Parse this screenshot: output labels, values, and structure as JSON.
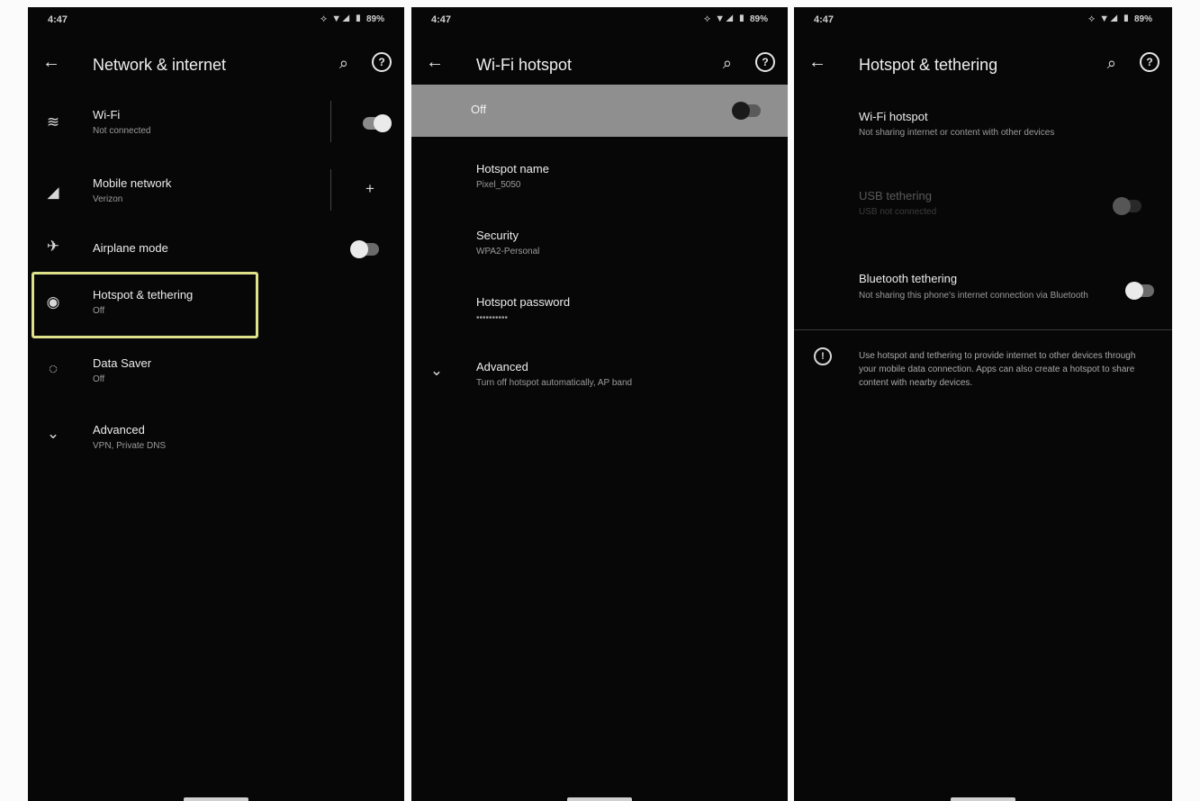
{
  "screens": [
    {
      "status": {
        "time": "4:47",
        "icons": "⟡ ▼◢ ▮",
        "battery": "89%"
      },
      "appbar": {
        "title": "Network & internet"
      },
      "rows": [
        {
          "label": "Wi-Fi",
          "sub": "Not connected"
        },
        {
          "label": "Mobile network",
          "sub": "Verizon"
        },
        {
          "label": "Airplane mode",
          "sub": ""
        },
        {
          "label": "Hotspot & tethering",
          "sub": "Off"
        },
        {
          "label": "Data Saver",
          "sub": "Off"
        },
        {
          "label": "Advanced",
          "sub": "VPN, Private DNS"
        }
      ]
    },
    {
      "status": {
        "time": "4:47",
        "icons": "⟡ ▼◢ ▮",
        "battery": "89%"
      },
      "appbar": {
        "title": "Wi-Fi hotspot"
      },
      "switch": {
        "label": "Off"
      },
      "rows": [
        {
          "label": "Hotspot name",
          "sub": "Pixel_5050"
        },
        {
          "label": "Security",
          "sub": "WPA2-Personal"
        },
        {
          "label": "Hotspot password",
          "sub": "••••••••••"
        },
        {
          "label": "Advanced",
          "sub": "Turn off hotspot automatically, AP band"
        }
      ]
    },
    {
      "status": {
        "time": "4:47",
        "icons": "⟡ ▼◢ ▮",
        "battery": "89%"
      },
      "appbar": {
        "title": "Hotspot & tethering"
      },
      "rows": [
        {
          "label": "Wi-Fi hotspot",
          "sub": "Not sharing internet or content with other devices"
        },
        {
          "label": "USB tethering",
          "sub": "USB not connected"
        },
        {
          "label": "Bluetooth tethering",
          "sub": "Not sharing this phone's internet connection via Bluetooth"
        }
      ],
      "info": "Use hotspot and tethering to provide internet to other devices through your mobile data connection. Apps can also create a hotspot to share content with nearby devices."
    }
  ]
}
